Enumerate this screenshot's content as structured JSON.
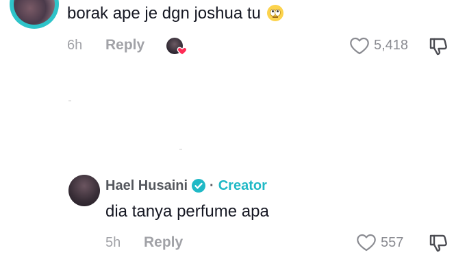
{
  "comment": {
    "text": "borak ape je dgn joshua tu",
    "emoji": "face-with-rolling-eyes",
    "time": "6h",
    "reply_label": "Reply",
    "like_count": "5,418"
  },
  "reply": {
    "author": "Hael Husaini",
    "separator": "·",
    "role_label": "Creator",
    "text": "dia tanya perfume apa",
    "time": "5h",
    "reply_label": "Reply",
    "like_count": "557"
  },
  "colors": {
    "avatar_ring": "#2ec4c9",
    "creator": "#20b9c6",
    "verified": "#20b9c6",
    "heart_badge": "#fe2c55",
    "meta_text": "#a1a2a7"
  },
  "icons": {
    "like": "heart-outline-icon",
    "dislike": "thumbs-down-icon",
    "verified": "verified-check-icon",
    "creator_liked": "heart-badge-icon"
  }
}
